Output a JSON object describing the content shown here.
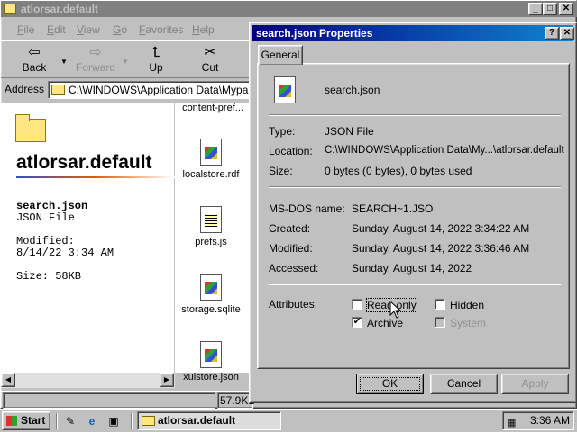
{
  "explorer": {
    "title": "atlorsar.default",
    "menu": [
      "File",
      "Edit",
      "View",
      "Go",
      "Favorites",
      "Help"
    ],
    "toolbar": {
      "back": "Back",
      "forward": "Forward",
      "up": "Up",
      "cut": "Cut"
    },
    "address_label": "Address",
    "address_value": "C:\\WINDOWS\\Application Data\\Mypal\\P",
    "folder_name": "atlorsar.default",
    "selection": {
      "name": "search.json",
      "type": "JSON File",
      "modified_label": "Modified:",
      "modified_value": "8/14/22 3:34 AM",
      "size": "Size: 58KB"
    },
    "files": [
      {
        "name": "content-pref..."
      },
      {
        "name": "localstore.rdf"
      },
      {
        "name": "prefs.js"
      },
      {
        "name": "storage.sqlite"
      },
      {
        "name": "xulstore.json"
      }
    ],
    "status_size": "57.9KB"
  },
  "dialog": {
    "title": "search.json Properties",
    "tab": "General",
    "filename": "search.json",
    "labels": {
      "type": "Type:",
      "location": "Location:",
      "size": "Size:",
      "msdos": "MS-DOS name:",
      "created": "Created:",
      "modified": "Modified:",
      "accessed": "Accessed:",
      "attributes": "Attributes:"
    },
    "values": {
      "type": "JSON File",
      "location": "C:\\WINDOWS\\Application Data\\My...\\atlorsar.default",
      "size": "0 bytes (0 bytes), 0 bytes used",
      "msdos": "SEARCH~1.JSO",
      "created": "Sunday, August 14, 2022 3:34:22 AM",
      "modified": "Sunday, August 14, 2022 3:36:46 AM",
      "accessed": "Sunday, August 14, 2022"
    },
    "attributes": {
      "readonly": {
        "label": "Read-only",
        "checked": false
      },
      "hidden": {
        "label": "Hidden",
        "checked": false
      },
      "archive": {
        "label": "Archive",
        "checked": true
      },
      "system": {
        "label": "System",
        "checked": false
      }
    },
    "buttons": {
      "ok": "OK",
      "cancel": "Cancel",
      "apply": "Apply"
    }
  },
  "taskbar": {
    "start": "Start",
    "task": "atlorsar.default",
    "clock": "3:36 AM"
  }
}
